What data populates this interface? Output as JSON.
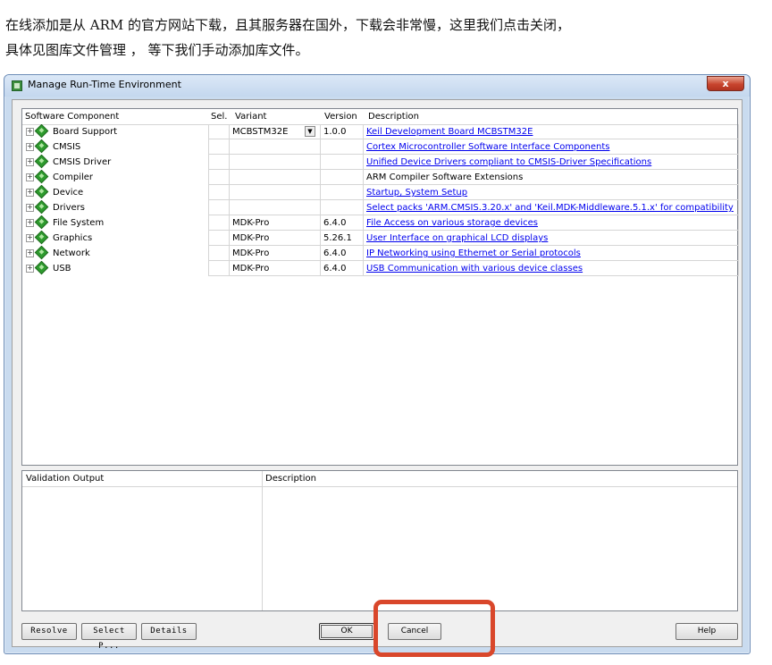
{
  "intro": {
    "line1": "在线添加是从 ARM 的官方网站下载，且其服务器在国外，下载会非常慢，这里我们点击关闭，",
    "line2": "具体见图库文件管理 ， 等下我们手动添加库文件。"
  },
  "window": {
    "title": "Manage Run-Time Environment",
    "close_label": "x"
  },
  "grid": {
    "headers": {
      "component": "Software Component",
      "sel": "Sel.",
      "variant": "Variant",
      "version": "Version",
      "description": "Description"
    },
    "rows": [
      {
        "component": "Board Support",
        "variant": "MCBSTM32E",
        "version": "1.0.0",
        "description": "Keil Development Board MCBSTM32E",
        "link": true
      },
      {
        "component": "CMSIS",
        "variant": "",
        "version": "",
        "description": "Cortex Microcontroller Software Interface Components",
        "link": true
      },
      {
        "component": "CMSIS Driver",
        "variant": "",
        "version": "",
        "description": "Unified Device Drivers compliant to CMSIS-Driver Specifications",
        "link": true
      },
      {
        "component": "Compiler",
        "variant": "",
        "version": "",
        "description": "ARM Compiler Software Extensions",
        "link": false
      },
      {
        "component": "Device",
        "variant": "",
        "version": "",
        "description": "Startup, System Setup",
        "link": true
      },
      {
        "component": "Drivers",
        "variant": "",
        "version": "",
        "description": "Select packs 'ARM.CMSIS.3.20.x' and 'Keil.MDK-Middleware.5.1.x' for compatibility",
        "link": true
      },
      {
        "component": "File System",
        "variant": "MDK-Pro",
        "version": "6.4.0",
        "description": "File Access on various storage devices",
        "link": true
      },
      {
        "component": "Graphics",
        "variant": "MDK-Pro",
        "version": "5.26.1",
        "description": "User Interface on graphical LCD displays",
        "link": true
      },
      {
        "component": "Network",
        "variant": "MDK-Pro",
        "version": "6.4.0",
        "description": "IP Networking using Ethernet or Serial protocols",
        "link": true
      },
      {
        "component": "USB",
        "variant": "MDK-Pro",
        "version": "6.4.0",
        "description": "USB Communication with various device classes",
        "link": true
      }
    ]
  },
  "validation": {
    "headers": {
      "output": "Validation Output",
      "description": "Description"
    }
  },
  "buttons": {
    "resolve": "Resolve",
    "select_packs": "Select P...",
    "details": "Details",
    "ok": "OK",
    "cancel": "Cancel",
    "help": "Help"
  },
  "colors": {
    "highlight": "#d9472b",
    "link": "#0000ee"
  },
  "icons": {
    "expand": "plus-box-icon",
    "component": "green-diamond-icon",
    "dropdown": "chevron-down-icon"
  }
}
